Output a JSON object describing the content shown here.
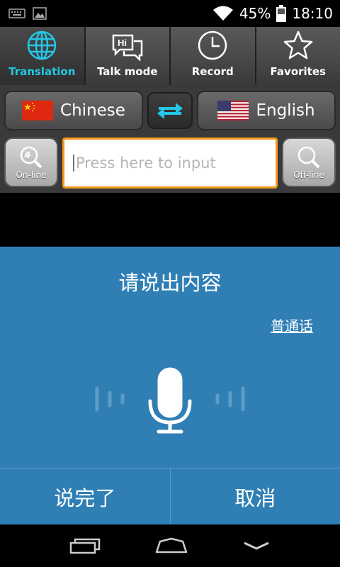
{
  "status": {
    "battery": "45%",
    "time": "18:10"
  },
  "tabs": [
    {
      "label": "Translation",
      "icon": "globe-icon",
      "active": true
    },
    {
      "label": "Talk mode",
      "icon": "chat-icon",
      "active": false
    },
    {
      "label": "Record",
      "icon": "clock-icon",
      "active": false
    },
    {
      "label": "Favorites",
      "icon": "star-icon",
      "active": false
    }
  ],
  "languages": {
    "source": "Chinese",
    "target": "English"
  },
  "search": {
    "online_label": "On-line",
    "offline_label": "Off-line",
    "placeholder": "Press here to input",
    "value": ""
  },
  "voice": {
    "prompt": "请说出内容",
    "dialect": "普通话"
  },
  "actions": {
    "done": "说完了",
    "cancel": "取消"
  },
  "colors": {
    "accent": "#24c7e6",
    "voice_panel": "#2f7fb5",
    "input_border": "#f49a1f"
  }
}
